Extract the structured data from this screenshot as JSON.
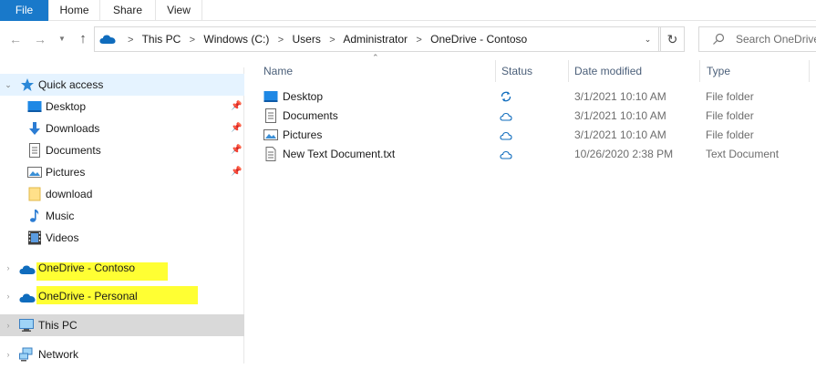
{
  "ribbon": {
    "tabs": [
      "File",
      "Home",
      "Share",
      "View"
    ]
  },
  "address": {
    "crumbs": [
      "This PC",
      "Windows (C:)",
      "Users",
      "Administrator",
      "OneDrive - Contoso"
    ],
    "separator": ">"
  },
  "search": {
    "placeholder": "Search OneDrive"
  },
  "sidebar": {
    "quick_access": "Quick access",
    "items": [
      {
        "label": "Desktop",
        "icon": "desktop-icon",
        "pinned": true
      },
      {
        "label": "Downloads",
        "icon": "downloads-icon",
        "pinned": true
      },
      {
        "label": "Documents",
        "icon": "documents-icon",
        "pinned": true
      },
      {
        "label": "Pictures",
        "icon": "pictures-icon",
        "pinned": true
      },
      {
        "label": "download",
        "icon": "folder-icon",
        "pinned": false
      },
      {
        "label": "Music",
        "icon": "music-icon",
        "pinned": false
      },
      {
        "label": "Videos",
        "icon": "videos-icon",
        "pinned": false
      }
    ],
    "onedrive_contoso": "OneDrive - Contoso",
    "onedrive_personal": "OneDrive - Personal",
    "this_pc": "This PC",
    "network": "Network"
  },
  "columns": {
    "name": "Name",
    "status": "Status",
    "date": "Date modified",
    "type": "Type"
  },
  "files": [
    {
      "name": "Desktop",
      "icon": "desktop-folder-icon",
      "status": "sync-pending-icon",
      "date": "3/1/2021 10:10 AM",
      "type": "File folder"
    },
    {
      "name": "Documents",
      "icon": "documents-folder-icon",
      "status": "cloud-icon",
      "date": "3/1/2021 10:10 AM",
      "type": "File folder"
    },
    {
      "name": "Pictures",
      "icon": "pictures-folder-icon",
      "status": "cloud-icon",
      "date": "3/1/2021 10:10 AM",
      "type": "File folder"
    },
    {
      "name": "New Text Document.txt",
      "icon": "text-file-icon",
      "status": "cloud-icon",
      "date": "10/26/2020 2:38 PM",
      "type": "Text Document"
    }
  ],
  "colors": {
    "file_tab": "#1979ca",
    "highlight": "#ffff33",
    "quick_access_bg": "#e5f3ff",
    "selected_bg": "#d9d9d9",
    "onedrive_blue": "#0f6cbd"
  }
}
